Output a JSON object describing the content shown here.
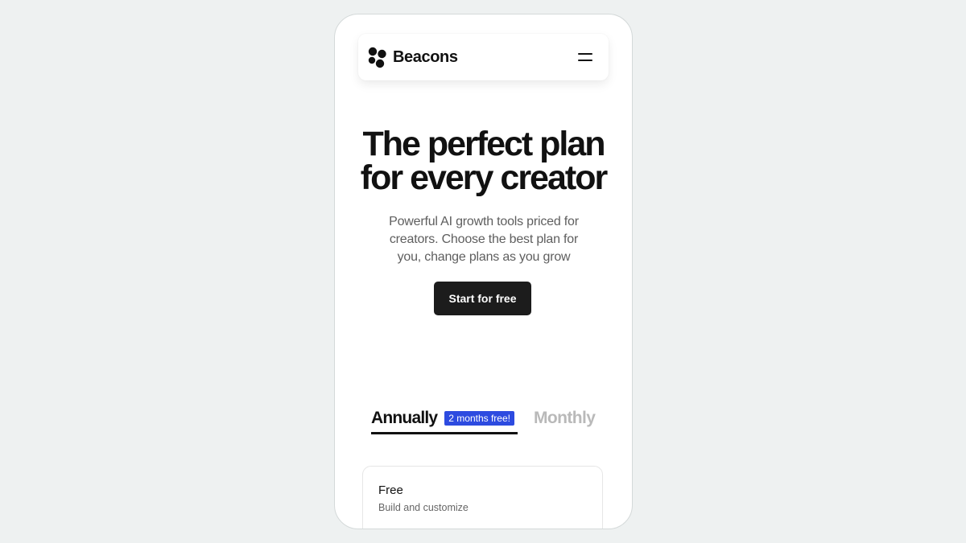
{
  "brand": {
    "name": "Beacons",
    "logo_icon": "beacons-logo-icon"
  },
  "nav": {
    "menu_icon": "hamburger-menu-icon"
  },
  "hero": {
    "title_line1": "The perfect plan",
    "title_line2": "for every creator",
    "subtitle": "Powerful AI growth tools priced for creators. Choose the best plan for you, change plans as you grow",
    "cta_label": "Start for free"
  },
  "billing": {
    "annual_label": "Annually",
    "annual_badge": "2 months free!",
    "monthly_label": "Monthly",
    "selected": "Annually"
  },
  "plans": [
    {
      "name": "Free",
      "description": "Build and customize"
    }
  ],
  "colors": {
    "accent": "#2d4be0",
    "cta_background": "#1c1c1c",
    "page_background": "#eef1f1"
  }
}
